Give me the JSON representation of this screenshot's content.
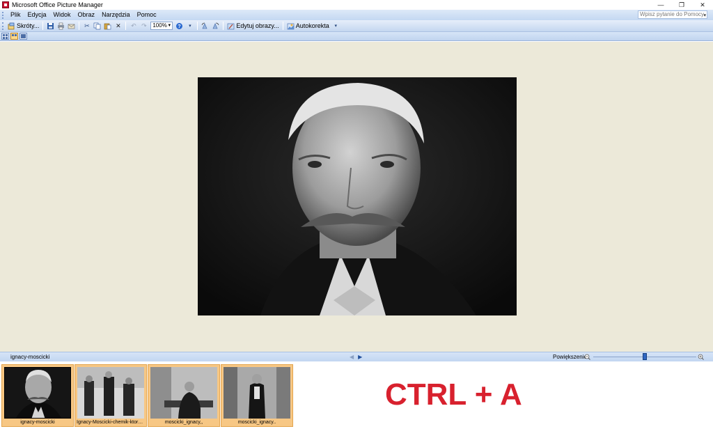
{
  "window": {
    "title": "Microsoft Office Picture Manager",
    "minimize_glyph": "—",
    "restore_glyph": "❐",
    "close_glyph": "✕"
  },
  "menu": {
    "items": [
      "Plik",
      "Edycja",
      "Widok",
      "Obraz",
      "Narzędzia",
      "Pomoc"
    ],
    "help_placeholder": "Wpisz pytanie do Pomocy"
  },
  "toolbar": {
    "shortcuts_label": "Skróty...",
    "zoom_value": "100%",
    "edit_label": "Edytuj obrazy...",
    "autocorrect_label": "Autokorekta"
  },
  "icons": {
    "shortcuts": "shortcuts-icon",
    "save": "save-icon",
    "print": "print-icon",
    "cut": "cut-icon",
    "copy": "copy-icon",
    "paste": "paste-icon",
    "delete": "delete-icon",
    "undo": "undo-icon",
    "redo": "redo-icon",
    "help": "help-icon",
    "rotate_left": "rotate-left-icon",
    "rotate_right": "rotate-right-icon",
    "edit": "edit-pictures-icon",
    "autocorrect": "autocorrect-icon"
  },
  "status": {
    "file_name": "ignacy-moscicki",
    "zoom_label": "Powiększenie:",
    "zoom_level": 0.5
  },
  "filmstrip": {
    "items": [
      {
        "caption": "ignacy-moscicki",
        "selected": true
      },
      {
        "caption": "Ignacy-Moscicki-chemik-ktory-zo...",
        "selected": true
      },
      {
        "caption": "moscicki_ignacy,,",
        "selected": true
      },
      {
        "caption": "moscicki_ignacy..",
        "selected": true
      }
    ]
  },
  "overlay": {
    "text": "CTRL + A",
    "color": "#d8212e"
  }
}
